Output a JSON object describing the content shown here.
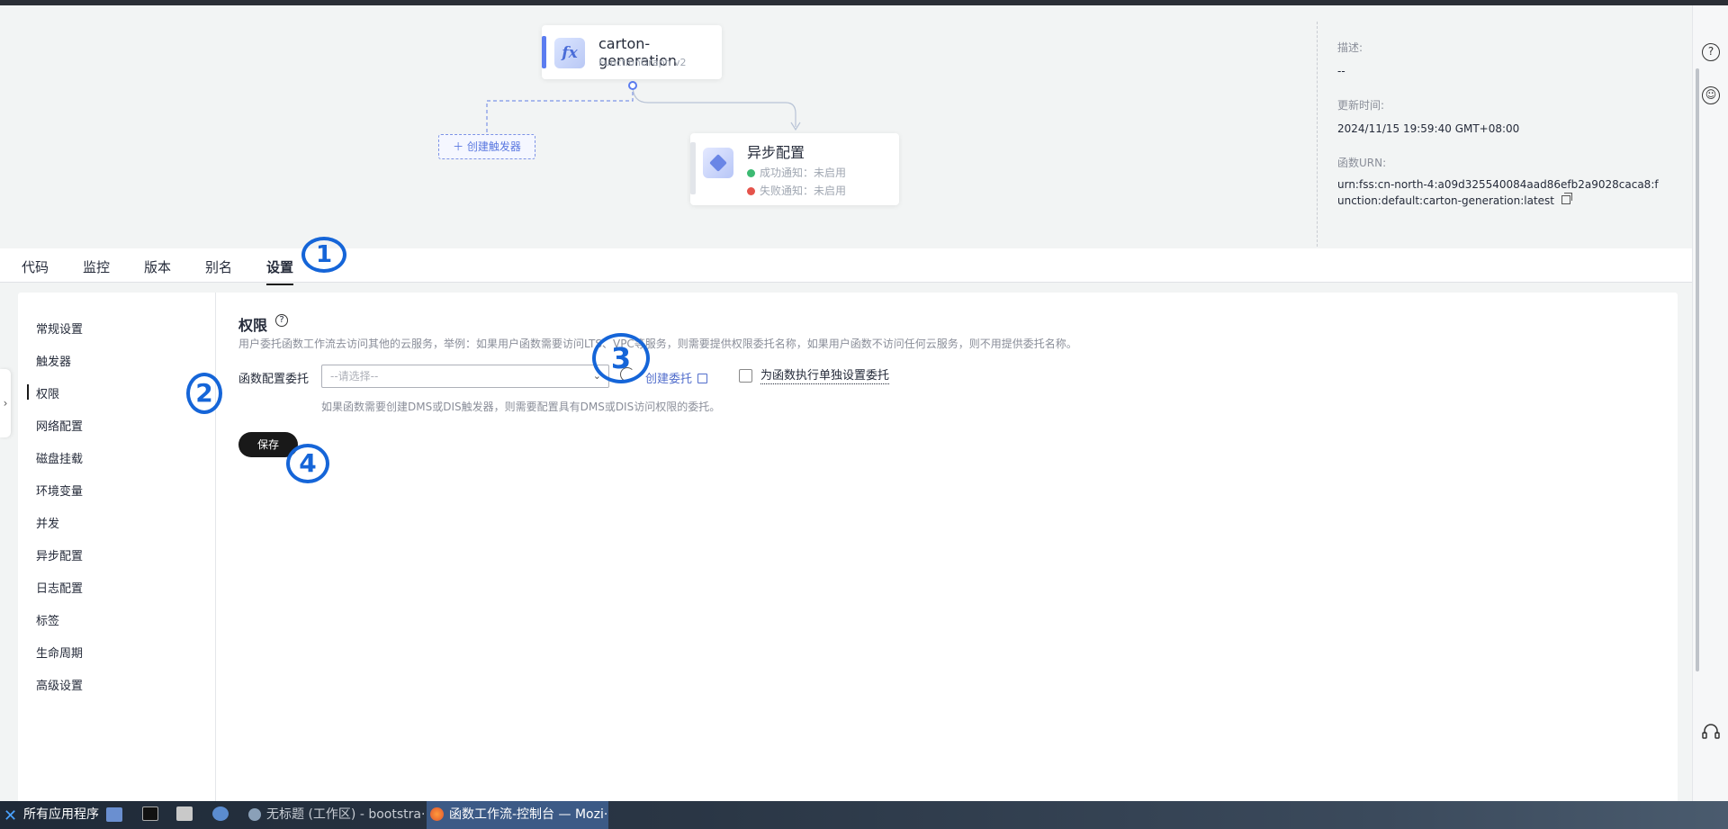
{
  "flow": {
    "function_name": "carton-generation",
    "function_type": "FunctionGraph v2",
    "fn_icon_glyph": "fx",
    "create_trigger": "＋ 创建触发器",
    "async_title": "异步配置",
    "success_notify": "成功通知：未启用",
    "fail_notify": "失败通知：未启用",
    "success_color": "#3cba72",
    "fail_color": "#e5534b"
  },
  "info": {
    "desc_label": "描述:",
    "desc_value": "--",
    "updated_label": "更新时间:",
    "updated_value": "2024/11/15 19:59:40 GMT+08:00",
    "urn_label": "函数URN:",
    "urn_value": "urn:fss:cn-north-4:a09d325540084aad86efb2a9028caca8:function:default:carton-generation:latest"
  },
  "tabs": [
    "代码",
    "监控",
    "版本",
    "别名",
    "设置"
  ],
  "active_tab": "设置",
  "sidenav": [
    "常规设置",
    "触发器",
    "权限",
    "网络配置",
    "磁盘挂载",
    "环境变量",
    "并发",
    "异步配置",
    "日志配置",
    "标签",
    "生命周期",
    "高级设置"
  ],
  "active_nav": "权限",
  "section": {
    "title": "权限",
    "description": "用户委托函数工作流去访问其他的云服务，举例：如果用户函数需要访问LTS、VPC等服务，则需要提供权限委托名称，如果用户函数不访问任何云服务，则不用提供委托名称。",
    "field_label": "函数配置委托",
    "select_placeholder": "--请选择--",
    "create_link": "创建委托",
    "checkbox_label": "为函数执行单独设置委托",
    "hint": "如果函数需要创建DMS或DIS触发器，则需要配置具有DMS或DIS访问权限的委托。",
    "save": "保存"
  },
  "annotations": [
    "1",
    "2",
    "3",
    "4"
  ],
  "rail_icons": [
    "?",
    "☺",
    "headset"
  ],
  "taskbar": {
    "start": "所有应用程序",
    "win1": "无标题 (工作区) - bootstra···",
    "win2": "函数工作流-控制台 — Mozi···"
  },
  "colors": {
    "accent": "#526ecc",
    "annotation": "#1565d8",
    "primary_button": "#191919"
  }
}
